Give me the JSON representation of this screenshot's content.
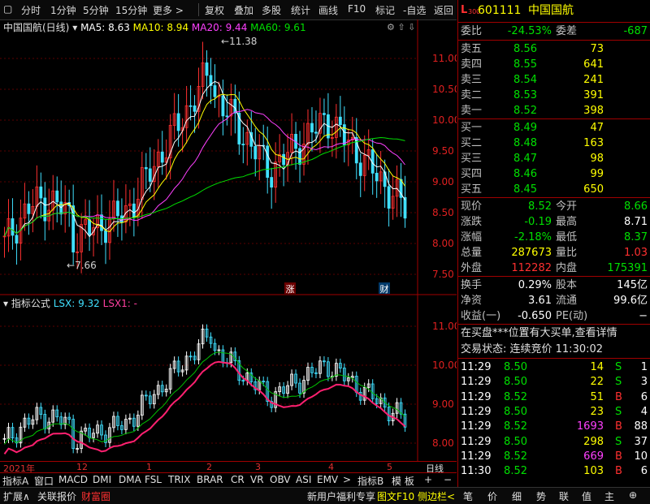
{
  "toolbar": {
    "items": [
      "分时",
      "1分钟",
      "5分钟",
      "15分钟",
      "更多 >",
      "复权",
      "叠加",
      "多股",
      "统计",
      "画线",
      "F10",
      "标记",
      "-自选",
      "返回"
    ]
  },
  "main_chart": {
    "title": "中国国航(日线)",
    "ma5": "MA5: 8.63",
    "ma10": "MA10: 8.94",
    "ma20": "MA20: 9.44",
    "ma60": "MA60: 9.61",
    "high_label": "11.38",
    "low_label": "7.66",
    "y_ticks": [
      "11.00",
      "10.50",
      "10.00",
      "9.50",
      "9.00",
      "8.50",
      "8.00",
      "7.50"
    ],
    "marker_up": "涨",
    "marker_fin": "财"
  },
  "indicator_chart": {
    "title": "指标公式",
    "lsx": "LSX: 9.32",
    "lsx1": "LSX1: -",
    "y_ticks": [
      "11.00",
      "10.00",
      "9.00",
      "8.00"
    ]
  },
  "x_axis": {
    "labels": [
      "2021年",
      "12",
      "1",
      "2",
      "3",
      "4",
      "5"
    ],
    "period": "日线"
  },
  "tabs": [
    "指标A",
    "窗口",
    "MACD",
    "DMI",
    "DMA",
    "FSL",
    "TRIX",
    "BRAR",
    "CR",
    "VR",
    "OBV",
    "ASI",
    "EMV",
    ">",
    "指标B",
    "模 板",
    "+",
    "−"
  ],
  "quote": {
    "code": "601111",
    "name": "中国国航",
    "badge": "L",
    "badge_sub": "300",
    "webi_label": "委比",
    "webi": "-24.53%",
    "weicha_label": "委差",
    "weicha": "-687",
    "asks": [
      {
        "label": "卖五",
        "price": "8.56",
        "vol": "73"
      },
      {
        "label": "卖四",
        "price": "8.55",
        "vol": "641"
      },
      {
        "label": "卖三",
        "price": "8.54",
        "vol": "241"
      },
      {
        "label": "卖二",
        "price": "8.53",
        "vol": "391"
      },
      {
        "label": "卖一",
        "price": "8.52",
        "vol": "398"
      }
    ],
    "bids": [
      {
        "label": "买一",
        "price": "8.49",
        "vol": "47"
      },
      {
        "label": "买二",
        "price": "8.48",
        "vol": "163"
      },
      {
        "label": "买三",
        "price": "8.47",
        "vol": "98"
      },
      {
        "label": "买四",
        "price": "8.46",
        "vol": "99"
      },
      {
        "label": "买五",
        "price": "8.45",
        "vol": "650"
      }
    ],
    "stats": [
      {
        "l1": "现价",
        "v1": "8.52",
        "l2": "今开",
        "v2": "8.66"
      },
      {
        "l1": "涨跌",
        "v1": "-0.19",
        "l2": "最高",
        "v2": "8.71"
      },
      {
        "l1": "涨幅",
        "v1": "-2.18%",
        "l2": "最低",
        "v2": "8.37"
      },
      {
        "l1": "总量",
        "v1": "287673",
        "l2": "量比",
        "v2": "1.03"
      },
      {
        "l1": "外盘",
        "v1": "112282",
        "l2": "内盘",
        "v2": "175391"
      }
    ],
    "fund": [
      {
        "l1": "换手",
        "v1": "0.29%",
        "l2": "股本",
        "v2": "145亿"
      },
      {
        "l1": "净资",
        "v1": "3.61",
        "l2": "流通",
        "v2": "99.6亿"
      },
      {
        "l1": "收益(一)",
        "v1": "-0.650",
        "l2": "PE(动)",
        "v2": "−"
      }
    ],
    "news": "在买盘***位置有大买单,查看详情",
    "trade_status": "交易状态: 连续竞价 11:30:02",
    "ticks": [
      {
        "t": "11:29",
        "p": "8.50",
        "v": "14",
        "s": "S"
      },
      {
        "t": "11:29",
        "p": "8.50",
        "v": "22",
        "s": "S"
      },
      {
        "t": "11:29",
        "p": "8.52",
        "v": "51",
        "s": "B"
      },
      {
        "t": "11:29",
        "p": "8.50",
        "v": "23",
        "s": "S"
      },
      {
        "t": "11:29",
        "p": "8.52",
        "v": "1693",
        "s": "B"
      },
      {
        "t": "11:29",
        "p": "8.50",
        "v": "298",
        "s": "S"
      },
      {
        "t": "11:29",
        "p": "8.52",
        "v": "669",
        "s": "B"
      },
      {
        "t": "11:30",
        "p": "8.52",
        "v": "103",
        "s": "B"
      }
    ],
    "tick_counts": [
      "1",
      "3",
      "6",
      "4",
      "88",
      "37",
      "10",
      "6"
    ]
  },
  "status_bar": {
    "left": [
      "扩展∧",
      "关联报价",
      "财富圈"
    ],
    "promo": "新用户福利专享",
    "f10": "图文F10",
    "sidebar": "侧边栏<",
    "right": [
      "笔",
      "价",
      "细",
      "势",
      "联",
      "值",
      "主",
      "⊕"
    ]
  }
}
